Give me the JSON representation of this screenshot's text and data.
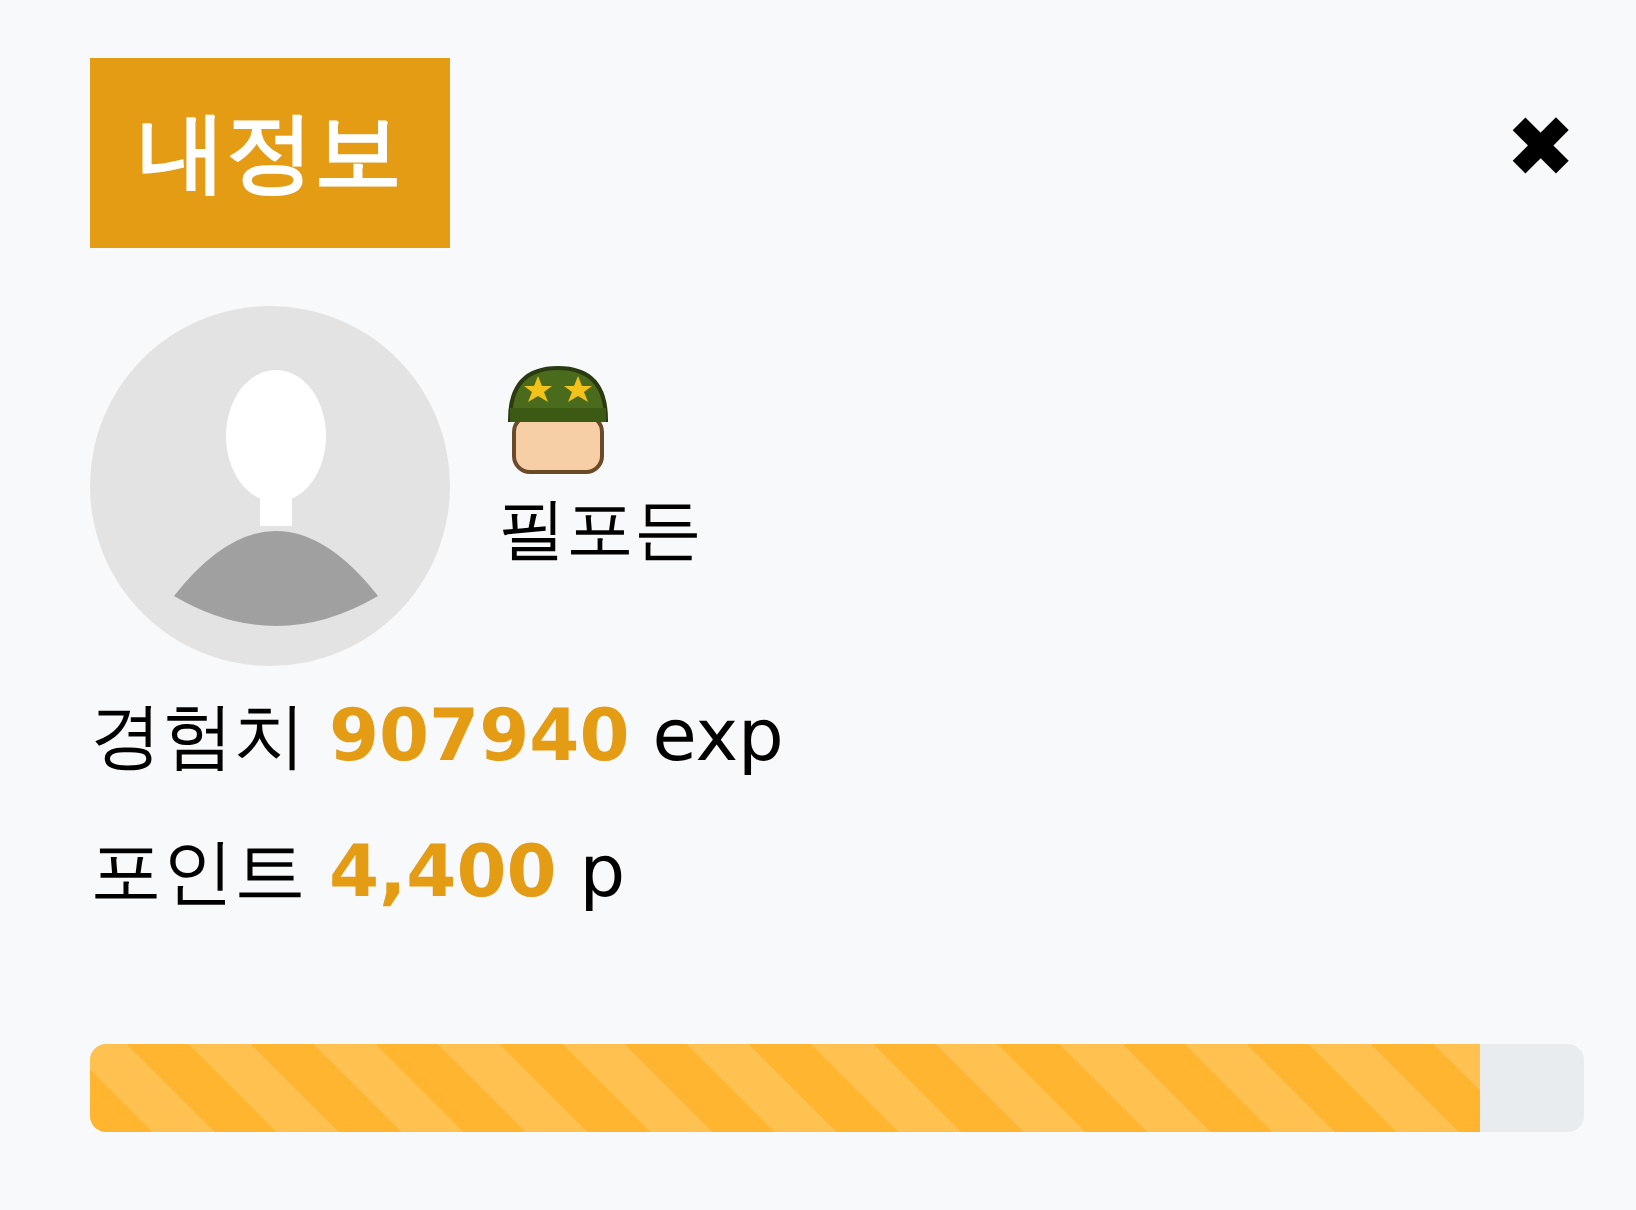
{
  "title": "내정보",
  "close": {
    "label": "✖"
  },
  "profile": {
    "name": "필포든"
  },
  "stats": [
    {
      "label": "경험치",
      "value": "907940",
      "unit": "exp"
    },
    {
      "label": "포인트",
      "value": "4,400",
      "unit": "p"
    }
  ],
  "progress": {
    "level": 0.93
  }
}
